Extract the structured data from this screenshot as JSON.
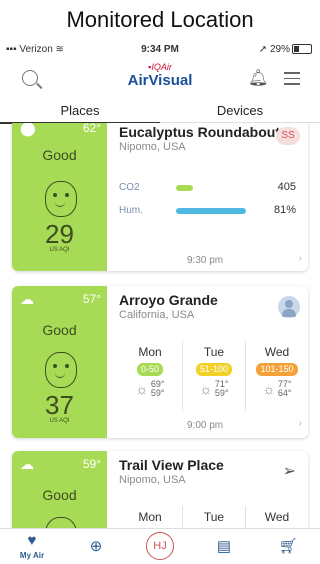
{
  "caption": "Monitored Location",
  "status_bar": {
    "carrier": "Verizon",
    "time": "9:34 PM",
    "battery": "29%"
  },
  "header": {
    "brand_top": "IQAir",
    "brand_main": "AirVisual"
  },
  "tabs": [
    {
      "label": "Places",
      "active": true
    },
    {
      "label": "Devices",
      "active": false
    }
  ],
  "cards": [
    {
      "name": "Eucalyptus Roundabout",
      "location": "Nipomo, USA",
      "badge": "SS",
      "temp": "62°",
      "status": "Good",
      "aqi": "29",
      "aqi_unit": "US AQI",
      "metrics": [
        {
          "label": "CO2",
          "value": "405",
          "fill": 0.2,
          "color": "#a7db55"
        },
        {
          "label": "Hum.",
          "value": "81%",
          "fill": 0.81,
          "color": "#4fb8e0"
        }
      ],
      "updated": "9:30 pm"
    },
    {
      "name": "Arroyo Grande",
      "location": "California, USA",
      "temp": "57°",
      "status": "Good",
      "aqi": "37",
      "aqi_unit": "US AQI",
      "forecast": [
        {
          "day": "Mon",
          "range": "0-50",
          "color": "#a7db55",
          "hi": "69°",
          "lo": "59°"
        },
        {
          "day": "Tue",
          "range": "51-100",
          "color": "#f2d026",
          "hi": "71°",
          "lo": "59°"
        },
        {
          "day": "Wed",
          "range": "101-150",
          "color": "#f5a13a",
          "hi": "77°",
          "lo": "64°"
        }
      ],
      "updated": "9:00 pm"
    },
    {
      "name": "Trail View Place",
      "location": "Nipomo, USA",
      "temp": "59°",
      "status": "Good",
      "forecast_days": [
        "Mon",
        "Tue",
        "Wed"
      ]
    }
  ],
  "bottom_nav": [
    {
      "label": "My Air",
      "icon": "heart-location-icon"
    },
    {
      "label": "",
      "icon": "globe-icon"
    },
    {
      "label": "HJ",
      "icon": "profile-initials"
    },
    {
      "label": "",
      "icon": "news-icon"
    },
    {
      "label": "",
      "icon": "cart-icon"
    }
  ]
}
